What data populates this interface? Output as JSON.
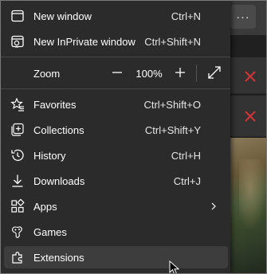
{
  "menu": {
    "top_items": [
      {
        "label": "New window",
        "shortcut": "Ctrl+N",
        "icon": "new-window-icon"
      },
      {
        "label": "New InPrivate window",
        "shortcut": "Ctrl+Shift+N",
        "icon": "inprivate-icon"
      }
    ],
    "zoom": {
      "label": "Zoom",
      "minus": "—",
      "value": "100%",
      "plus": "+"
    },
    "items": [
      {
        "label": "Favorites",
        "shortcut": "Ctrl+Shift+O",
        "icon": "favorites-icon"
      },
      {
        "label": "Collections",
        "shortcut": "Ctrl+Shift+Y",
        "icon": "collections-icon"
      },
      {
        "label": "History",
        "shortcut": "Ctrl+H",
        "icon": "history-icon"
      },
      {
        "label": "Downloads",
        "shortcut": "Ctrl+J",
        "icon": "downloads-icon"
      },
      {
        "label": "Apps",
        "shortcut": "",
        "icon": "apps-icon",
        "submenu": true
      },
      {
        "label": "Games",
        "shortcut": "",
        "icon": "games-icon"
      },
      {
        "label": "Extensions",
        "shortcut": "",
        "icon": "extensions-icon",
        "hovered": true
      }
    ]
  },
  "background": {
    "more_button": "···"
  },
  "colors": {
    "menu_bg": "#2b2b2b",
    "hover_bg": "#3d3d3d",
    "close_red": "#d13438",
    "text": "#ffffff"
  }
}
